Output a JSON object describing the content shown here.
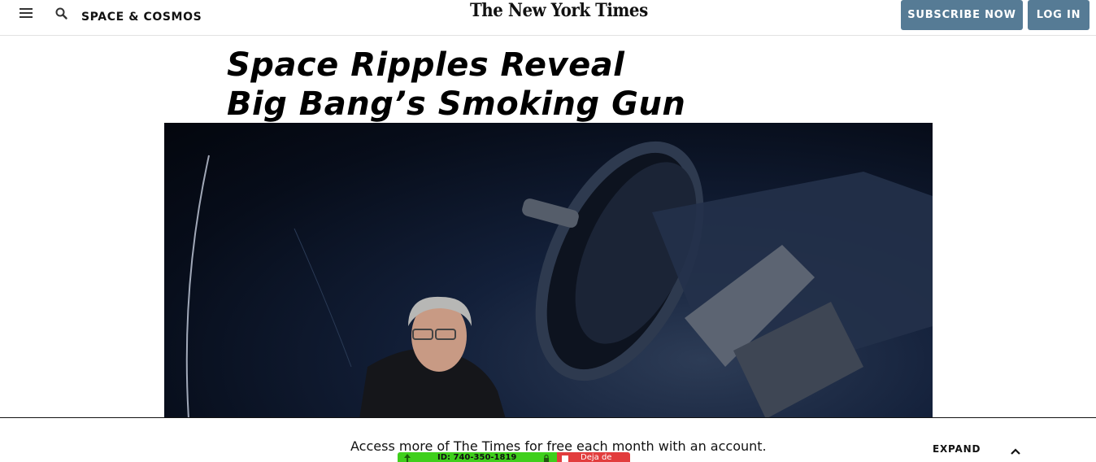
{
  "header": {
    "menu_icon": "hamburger-menu-icon",
    "search_icon": "search-icon",
    "section": "SPACE & COSMOS",
    "logo": "The New York Times",
    "subscribe": "SUBSCRIBE NOW",
    "login": "LOG IN",
    "button_color": "#567b95"
  },
  "article": {
    "headline_line1": "Space Ripples Reveal",
    "headline_line2": "Big Bang’s Smoking Gun"
  },
  "bottom_bar": {
    "message": "Access more of The Times for free each month with an account.",
    "expand": "EXPAND",
    "expand_icon": "chevron-up-icon"
  },
  "extension_bar": {
    "id_text": "ID: 740-350-1819",
    "stop_text": "Deja de",
    "green": "#3fcf1c",
    "red": "#e23d3d"
  }
}
